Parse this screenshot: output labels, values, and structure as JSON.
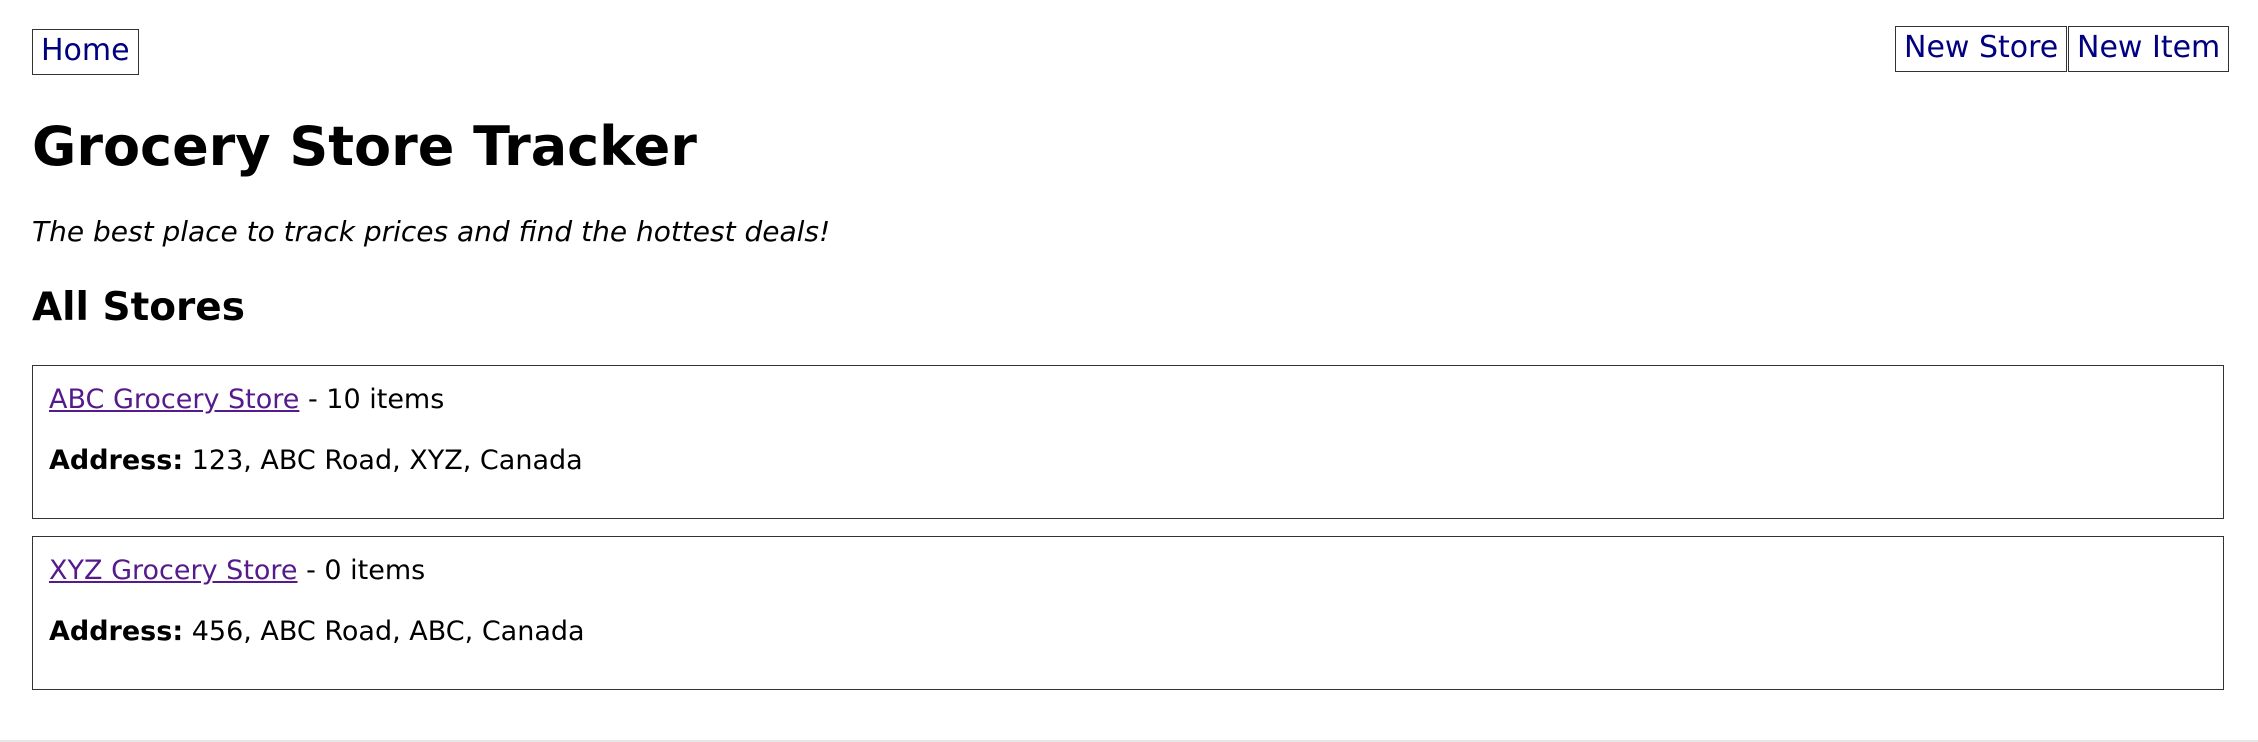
{
  "nav": {
    "home_label": "Home",
    "new_store_label": "New Store",
    "new_item_label": "New Item"
  },
  "header": {
    "title": "Grocery Store Tracker",
    "tagline": "The best place to track prices and find the hottest deals!"
  },
  "stores_section": {
    "heading": "All Stores",
    "address_label": "Address:",
    "items": [
      {
        "name": "ABC Grocery Store",
        "count_text": " - 10 items",
        "address": " 123, ABC Road, XYZ, Canada"
      },
      {
        "name": "XYZ Grocery Store",
        "count_text": " - 0 items",
        "address": " 456, ABC Road, ABC, Canada"
      }
    ]
  },
  "colors": {
    "nav_link": "#000080",
    "visited_link": "#551a8b",
    "border": "#333333"
  }
}
